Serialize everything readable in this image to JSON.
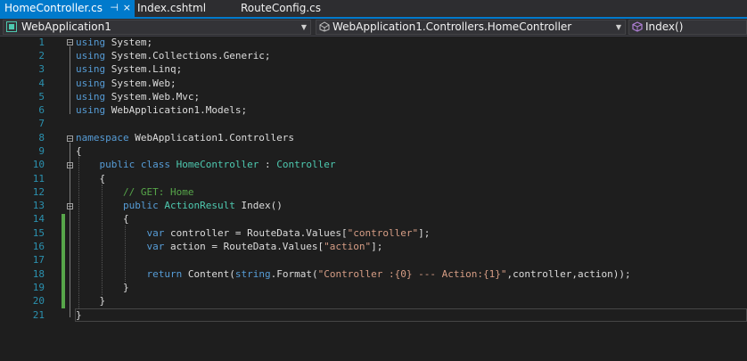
{
  "tabs": [
    {
      "label": "HomeController.cs",
      "active": true,
      "pin": "⊣",
      "close": "×"
    },
    {
      "label": "Index.cshtml",
      "active": false
    },
    {
      "label": "RouteConfig.cs",
      "active": false
    }
  ],
  "navbar": {
    "project": "WebApplication1",
    "class_path": "WebApplication1.Controllers.HomeController",
    "member": "Index()"
  },
  "editor": {
    "line_numbers": [
      "1",
      "2",
      "3",
      "4",
      "5",
      "6",
      "7",
      "8",
      "9",
      "10",
      "11",
      "12",
      "13",
      "14",
      "15",
      "16",
      "17",
      "18",
      "19",
      "20",
      "21"
    ],
    "lines": {
      "l1": [
        "using",
        " System;"
      ],
      "l2": [
        "using",
        " System.Collections.Generic;"
      ],
      "l3": [
        "using",
        " System.Linq;"
      ],
      "l4": [
        "using",
        " System.Web;"
      ],
      "l5": [
        "using",
        " System.Web.Mvc;"
      ],
      "l6": [
        "using",
        " WebApplication1.Models;"
      ],
      "l8": [
        "namespace",
        " WebApplication1.Controllers"
      ],
      "l9": "{",
      "l10": [
        "    ",
        "public",
        " ",
        "class",
        " ",
        "HomeController",
        " : ",
        "Controller"
      ],
      "l11": "    {",
      "l12": [
        "        ",
        "// GET: Home"
      ],
      "l13": [
        "        ",
        "public",
        " ",
        "ActionResult",
        " Index()"
      ],
      "l14": "        {",
      "l15": [
        "            ",
        "var",
        " controller = RouteData.Values[",
        "\"controller\"",
        "];"
      ],
      "l16": [
        "            ",
        "var",
        " action = RouteData.Values[",
        "\"action\"",
        "];"
      ],
      "l18": [
        "            ",
        "return",
        " Content(",
        "string",
        ".Format(",
        "\"Controller :{0} --- Action:{1}\"",
        ",controller,action));"
      ],
      "l19": "        }",
      "l20": "    }",
      "l21": "}"
    }
  },
  "colors": {
    "accent": "#007acc",
    "keyword": "#569cd6",
    "type": "#4ec9b0",
    "string": "#d69d85",
    "comment": "#57a64a",
    "line_number": "#2b91af",
    "change_marker": "#57a64a"
  },
  "icons": {
    "project": "csharp-project-icon",
    "class_path": "class-icon",
    "member": "method-icon"
  }
}
